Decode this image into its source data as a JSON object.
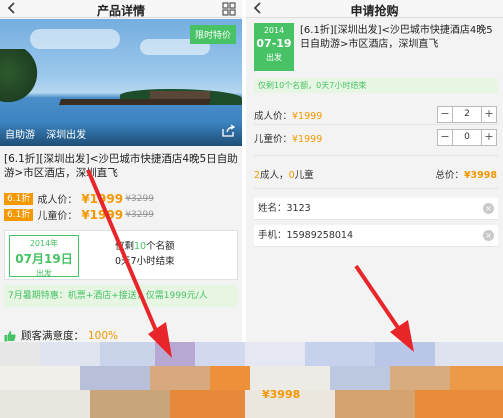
{
  "left": {
    "title": "产品详情",
    "sale_badge": "限时特价",
    "hero_tags": [
      "自助游",
      "深圳出发"
    ],
    "product_title": "[6.1折][深圳出发]<沙巴城市快捷酒店4晚5日自助游>市区酒店，深圳直飞",
    "discount": "6.1折",
    "adult_label": "成人价：",
    "adult_price": "¥1999",
    "adult_old": "¥3299",
    "child_label": "儿童价：",
    "child_price": "¥1999",
    "child_old": "¥3299",
    "date_year": "2014年",
    "date_day": "07月19日",
    "date_go": "出发",
    "remain_prefix": "仅剩",
    "remain_count": "10",
    "remain_suffix": "个名额",
    "remain_time": "0天7小时结束",
    "promo": "7月暑期特惠：机票+酒店+接送，仅需1999元/人",
    "satisfaction_label": "顾客满意度：",
    "satisfaction_value": "100%"
  },
  "right": {
    "title": "申请抢购",
    "date_year": "2014",
    "date_day": "07-19",
    "date_go": "出发",
    "product_title": "[6.1折][深圳出发]<沙巴城市快捷酒店4晚5日自助游>市区酒店，深圳直飞",
    "remain": "仅剩10个名额，0天7小时结束",
    "adult_label": "成人价：",
    "adult_price": "¥1999",
    "adult_qty": "2",
    "child_label": "儿童价：",
    "child_price": "¥1999",
    "child_qty": "0",
    "summary_adult_n": "2",
    "summary_adult": "成人，",
    "summary_child_n": "0",
    "summary_child": "儿童",
    "total_label": "总价：",
    "total_value": "¥3998",
    "name_label": "姓名：",
    "name_value": "3123",
    "phone_label": "手机：",
    "phone_value": "15989258014",
    "minus": "−",
    "plus": "+",
    "clear": "×",
    "bottom_price": "¥3998"
  },
  "colors": {
    "accent_green": "#47c265",
    "price_orange": "#f39800",
    "arrow_red": "#e8262a"
  }
}
